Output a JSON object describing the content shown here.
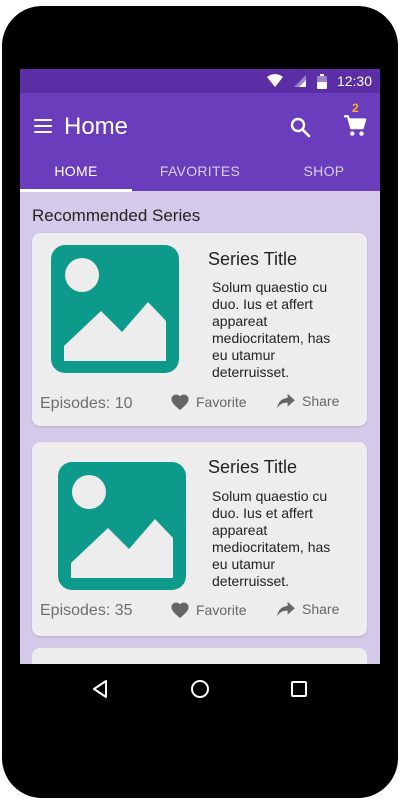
{
  "status_bar": {
    "time": "12:30"
  },
  "app_bar": {
    "title": "Home",
    "cart_count": "2"
  },
  "tabs": [
    {
      "label": "HOME"
    },
    {
      "label": "FAVORITES"
    },
    {
      "label": "SHOP"
    }
  ],
  "section": {
    "title": "Recommended Series"
  },
  "cards": [
    {
      "title": "Series Title",
      "description": "Solum quaestio cu duo. Ius et affert appareat mediocritatem, has eu utamur deterruisset.",
      "episodes": "Episodes: 10",
      "favorite_label": "Favorite",
      "share_label": "Share"
    },
    {
      "title": "Series Title",
      "description": "Solum quaestio cu duo. Ius et affert appareat mediocritatem, has eu utamur deterruisset.",
      "episodes": "Episodes: 35",
      "favorite_label": "Favorite",
      "share_label": "Share"
    }
  ],
  "colors": {
    "status_bar": "#5b2ea6",
    "app_bar": "#6a3dbd",
    "content_bg": "#d5c9e9",
    "card_bg": "#ededed",
    "thumbnail": "#0e9a8b",
    "badge": "#ffb02e"
  },
  "icons": [
    "wifi-icon",
    "signal-icon",
    "battery-icon",
    "menu-icon",
    "search-icon",
    "cart-icon",
    "image-placeholder-icon",
    "heart-icon",
    "share-icon",
    "back-icon",
    "home-icon",
    "recents-icon"
  ]
}
